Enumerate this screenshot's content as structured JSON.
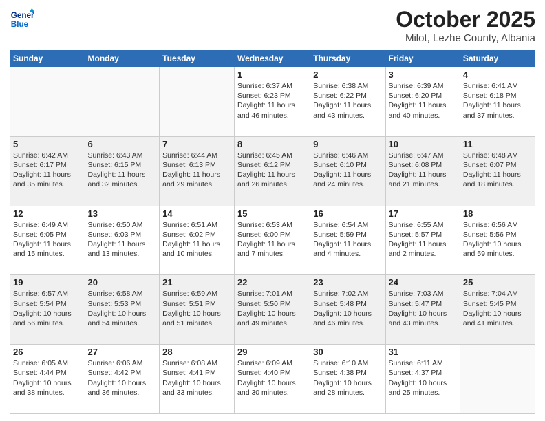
{
  "logo": {
    "line1": "General",
    "line2": "Blue"
  },
  "title": "October 2025",
  "subtitle": "Milot, Lezhe County, Albania",
  "weekdays": [
    "Sunday",
    "Monday",
    "Tuesday",
    "Wednesday",
    "Thursday",
    "Friday",
    "Saturday"
  ],
  "weeks": [
    [
      {
        "day": "",
        "info": ""
      },
      {
        "day": "",
        "info": ""
      },
      {
        "day": "",
        "info": ""
      },
      {
        "day": "1",
        "info": "Sunrise: 6:37 AM\nSunset: 6:23 PM\nDaylight: 11 hours\nand 46 minutes."
      },
      {
        "day": "2",
        "info": "Sunrise: 6:38 AM\nSunset: 6:22 PM\nDaylight: 11 hours\nand 43 minutes."
      },
      {
        "day": "3",
        "info": "Sunrise: 6:39 AM\nSunset: 6:20 PM\nDaylight: 11 hours\nand 40 minutes."
      },
      {
        "day": "4",
        "info": "Sunrise: 6:41 AM\nSunset: 6:18 PM\nDaylight: 11 hours\nand 37 minutes."
      }
    ],
    [
      {
        "day": "5",
        "info": "Sunrise: 6:42 AM\nSunset: 6:17 PM\nDaylight: 11 hours\nand 35 minutes."
      },
      {
        "day": "6",
        "info": "Sunrise: 6:43 AM\nSunset: 6:15 PM\nDaylight: 11 hours\nand 32 minutes."
      },
      {
        "day": "7",
        "info": "Sunrise: 6:44 AM\nSunset: 6:13 PM\nDaylight: 11 hours\nand 29 minutes."
      },
      {
        "day": "8",
        "info": "Sunrise: 6:45 AM\nSunset: 6:12 PM\nDaylight: 11 hours\nand 26 minutes."
      },
      {
        "day": "9",
        "info": "Sunrise: 6:46 AM\nSunset: 6:10 PM\nDaylight: 11 hours\nand 24 minutes."
      },
      {
        "day": "10",
        "info": "Sunrise: 6:47 AM\nSunset: 6:08 PM\nDaylight: 11 hours\nand 21 minutes."
      },
      {
        "day": "11",
        "info": "Sunrise: 6:48 AM\nSunset: 6:07 PM\nDaylight: 11 hours\nand 18 minutes."
      }
    ],
    [
      {
        "day": "12",
        "info": "Sunrise: 6:49 AM\nSunset: 6:05 PM\nDaylight: 11 hours\nand 15 minutes."
      },
      {
        "day": "13",
        "info": "Sunrise: 6:50 AM\nSunset: 6:03 PM\nDaylight: 11 hours\nand 13 minutes."
      },
      {
        "day": "14",
        "info": "Sunrise: 6:51 AM\nSunset: 6:02 PM\nDaylight: 11 hours\nand 10 minutes."
      },
      {
        "day": "15",
        "info": "Sunrise: 6:53 AM\nSunset: 6:00 PM\nDaylight: 11 hours\nand 7 minutes."
      },
      {
        "day": "16",
        "info": "Sunrise: 6:54 AM\nSunset: 5:59 PM\nDaylight: 11 hours\nand 4 minutes."
      },
      {
        "day": "17",
        "info": "Sunrise: 6:55 AM\nSunset: 5:57 PM\nDaylight: 11 hours\nand 2 minutes."
      },
      {
        "day": "18",
        "info": "Sunrise: 6:56 AM\nSunset: 5:56 PM\nDaylight: 10 hours\nand 59 minutes."
      }
    ],
    [
      {
        "day": "19",
        "info": "Sunrise: 6:57 AM\nSunset: 5:54 PM\nDaylight: 10 hours\nand 56 minutes."
      },
      {
        "day": "20",
        "info": "Sunrise: 6:58 AM\nSunset: 5:53 PM\nDaylight: 10 hours\nand 54 minutes."
      },
      {
        "day": "21",
        "info": "Sunrise: 6:59 AM\nSunset: 5:51 PM\nDaylight: 10 hours\nand 51 minutes."
      },
      {
        "day": "22",
        "info": "Sunrise: 7:01 AM\nSunset: 5:50 PM\nDaylight: 10 hours\nand 49 minutes."
      },
      {
        "day": "23",
        "info": "Sunrise: 7:02 AM\nSunset: 5:48 PM\nDaylight: 10 hours\nand 46 minutes."
      },
      {
        "day": "24",
        "info": "Sunrise: 7:03 AM\nSunset: 5:47 PM\nDaylight: 10 hours\nand 43 minutes."
      },
      {
        "day": "25",
        "info": "Sunrise: 7:04 AM\nSunset: 5:45 PM\nDaylight: 10 hours\nand 41 minutes."
      }
    ],
    [
      {
        "day": "26",
        "info": "Sunrise: 6:05 AM\nSunset: 4:44 PM\nDaylight: 10 hours\nand 38 minutes."
      },
      {
        "day": "27",
        "info": "Sunrise: 6:06 AM\nSunset: 4:42 PM\nDaylight: 10 hours\nand 36 minutes."
      },
      {
        "day": "28",
        "info": "Sunrise: 6:08 AM\nSunset: 4:41 PM\nDaylight: 10 hours\nand 33 minutes."
      },
      {
        "day": "29",
        "info": "Sunrise: 6:09 AM\nSunset: 4:40 PM\nDaylight: 10 hours\nand 30 minutes."
      },
      {
        "day": "30",
        "info": "Sunrise: 6:10 AM\nSunset: 4:38 PM\nDaylight: 10 hours\nand 28 minutes."
      },
      {
        "day": "31",
        "info": "Sunrise: 6:11 AM\nSunset: 4:37 PM\nDaylight: 10 hours\nand 25 minutes."
      },
      {
        "day": "",
        "info": ""
      }
    ]
  ]
}
